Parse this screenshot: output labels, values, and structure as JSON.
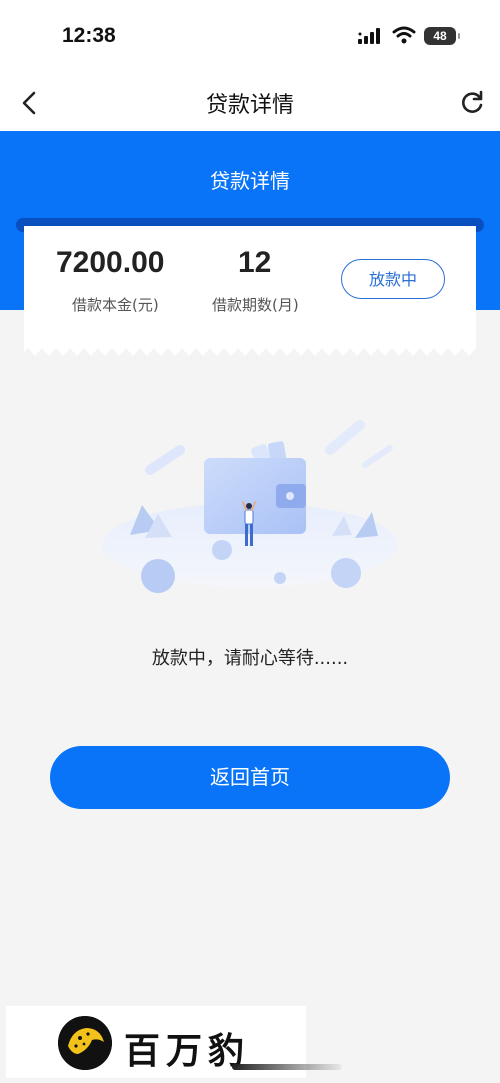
{
  "status_bar": {
    "time": "12:38",
    "battery": "48"
  },
  "nav": {
    "title": "贷款详情"
  },
  "banner": {
    "title": "贷款详情"
  },
  "loan": {
    "amount": "7200.00",
    "amount_label": "借款本金(元)",
    "term": "12",
    "term_label": "借款期数(月)",
    "status": "放款中"
  },
  "message": "放款中，请耐心等待......",
  "home_button": "返回首页",
  "brand": {
    "name": "百万豹"
  },
  "colors": {
    "primary": "#0a74f9",
    "badge": "#2a6fd6",
    "background": "#f4f4f4"
  },
  "icons": [
    "back-arrow-icon",
    "refresh-icon",
    "signal-icon",
    "wifi-icon",
    "battery-icon",
    "wallet-illustration",
    "leopard-logo"
  ]
}
